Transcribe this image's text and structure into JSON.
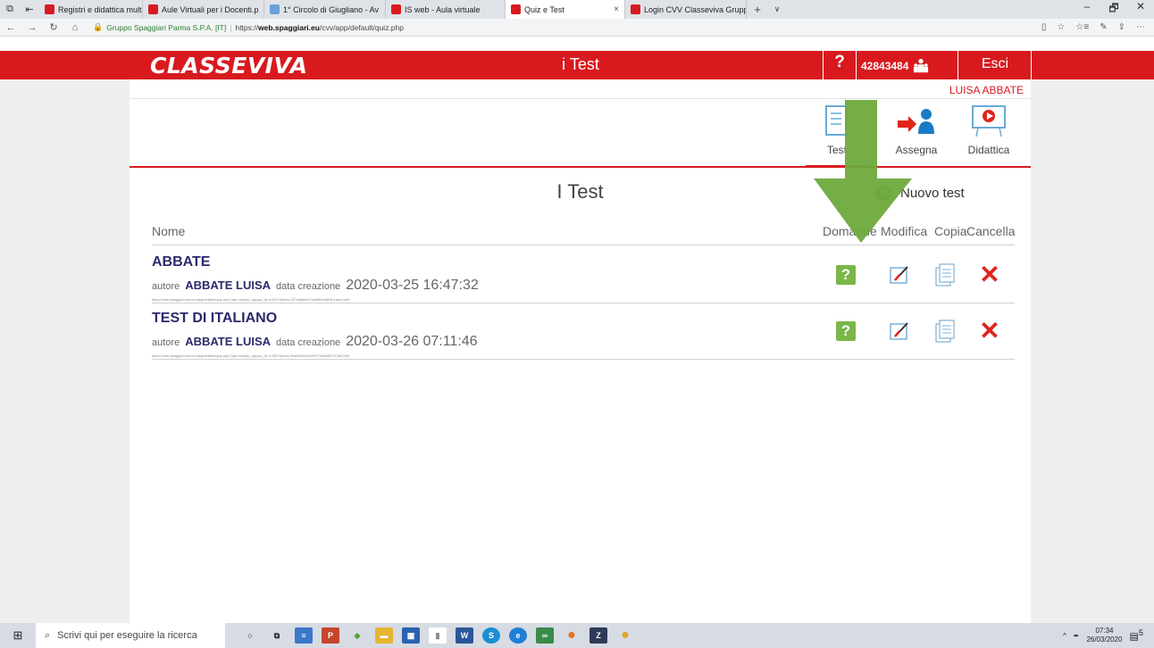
{
  "browser": {
    "tabs": [
      {
        "label": "Registri e didattica multime",
        "favicon_color": "#d81a1f",
        "active": false
      },
      {
        "label": "Aule Virtuali per i Docenti.p",
        "favicon_color": "#d81a1f",
        "active": false
      },
      {
        "label": "1° Circolo di Giugliano - Av",
        "favicon_color": "#6a9fd8",
        "active": false
      },
      {
        "label": "IS web - Aula virtuale",
        "favicon_color": "#d81a1f",
        "active": false
      },
      {
        "label": "Quiz e Test",
        "favicon_color": "#d81a1f",
        "active": true
      },
      {
        "label": "Login CVV Classeviva Grupp",
        "favicon_color": "#d81a1f",
        "active": false
      }
    ],
    "tab_close": "×",
    "new_tab": "+",
    "tab_list": "∨",
    "window_controls": {
      "minimize": "–",
      "maximize": "🗗",
      "close": "✕"
    },
    "nav": {
      "back": "←",
      "forward": "→",
      "reload": "↻",
      "home": "⌂"
    },
    "cert_label": "Gruppo Spaggiari Parma S.P.A. [IT]",
    "url_prefix": "https://",
    "url_host": "web.spaggiari.eu",
    "url_path": "/cvv/app/default/quiz.php",
    "addr_icons": {
      "reading": "▯",
      "favorite": "☆",
      "favorites_bar": "☆≡",
      "notes": "✎",
      "share": "⇪",
      "more": "⋯"
    }
  },
  "header": {
    "logo_text": "CLASSEVIVA",
    "title": "i Test",
    "help_label": "?",
    "user_code": "42843484",
    "logout_label": "Esci",
    "brand_color": "#d81a1f"
  },
  "user": {
    "name": "LUISA ABBATE"
  },
  "toolbar": {
    "items": [
      {
        "label": "Test",
        "icon": "document-icon",
        "active": true
      },
      {
        "label": "Assegna",
        "icon": "assign-person-icon",
        "active": false
      },
      {
        "label": "Didattica",
        "icon": "presentation-board-icon",
        "active": false
      }
    ]
  },
  "main": {
    "heading": "I Test",
    "new_test_label": "Nuovo test",
    "new_test_icon": "+",
    "columns": {
      "name": "Nome",
      "questions": "Domande",
      "edit": "Modifica",
      "copy": "Copia",
      "delete": "Cancella"
    },
    "rows": [
      {
        "title": "ABBATE",
        "author_label": "autore",
        "author": "ABBATE LUISA",
        "date_label": "data creazione",
        "date": "2020-03-25 16:47:32",
        "url": "https://web.spaggiari.eu/cvv/app/default/quiz.php?ope=simple_q&quiz_id=101513&cks=221da8a9121af8845a809b1aaa1cb9"
      },
      {
        "title": "TEST DI ITALIANO",
        "author_label": "autore",
        "author": "ABBATE LUISA",
        "date_label": "data creazione",
        "date": "2020-03-26 07:11:46",
        "url": "https://web.spaggiari.eu/cvv/app/default/quiz.php?ope=simple_q&quiz_id=103878&cks=f0a6f4499bc1f9274f46bf07d7a87e99"
      }
    ],
    "row_actions": {
      "questions": "?",
      "delete": "✕"
    }
  },
  "annotation": {
    "arrow_color": "#6ea93c"
  },
  "taskbar": {
    "start_icon": "⊞",
    "search_icon": "⌕",
    "search_placeholder": "Scrivi qui per eseguire la ricerca",
    "apps": [
      {
        "name": "cortana",
        "glyph": "○",
        "color": "#d7dbe3"
      },
      {
        "name": "task-view",
        "glyph": "⧉",
        "color": "#d7dbe3"
      },
      {
        "name": "app-blue",
        "glyph": "≡",
        "color": "#3a78c9"
      },
      {
        "name": "powerpoint",
        "glyph": "P",
        "color": "#c4462a"
      },
      {
        "name": "app-green",
        "glyph": "◆",
        "color": "#5aa03a"
      },
      {
        "name": "explorer",
        "glyph": "▬",
        "color": "#e6b530"
      },
      {
        "name": "store",
        "glyph": "▦",
        "color": "#2a62b0"
      },
      {
        "name": "notes",
        "glyph": "▮",
        "color": "#8a8a8a"
      },
      {
        "name": "word",
        "glyph": "W",
        "color": "#2b579a"
      },
      {
        "name": "skype",
        "glyph": "S",
        "color": "#1b8fd6"
      },
      {
        "name": "edge",
        "glyph": "e",
        "color": "#1f7ed6"
      },
      {
        "name": "tripadvisor",
        "glyph": "∞",
        "color": "#3a8a4a"
      },
      {
        "name": "firefox",
        "glyph": "●",
        "color": "#e2731c"
      },
      {
        "name": "app-dark",
        "glyph": "Z",
        "color": "#2d3a5a"
      },
      {
        "name": "chrome",
        "glyph": "●",
        "color": "#e0a32a"
      }
    ],
    "tray_up": "^",
    "time": "07:34",
    "date": "26/03/2020",
    "notification_count": "5"
  }
}
